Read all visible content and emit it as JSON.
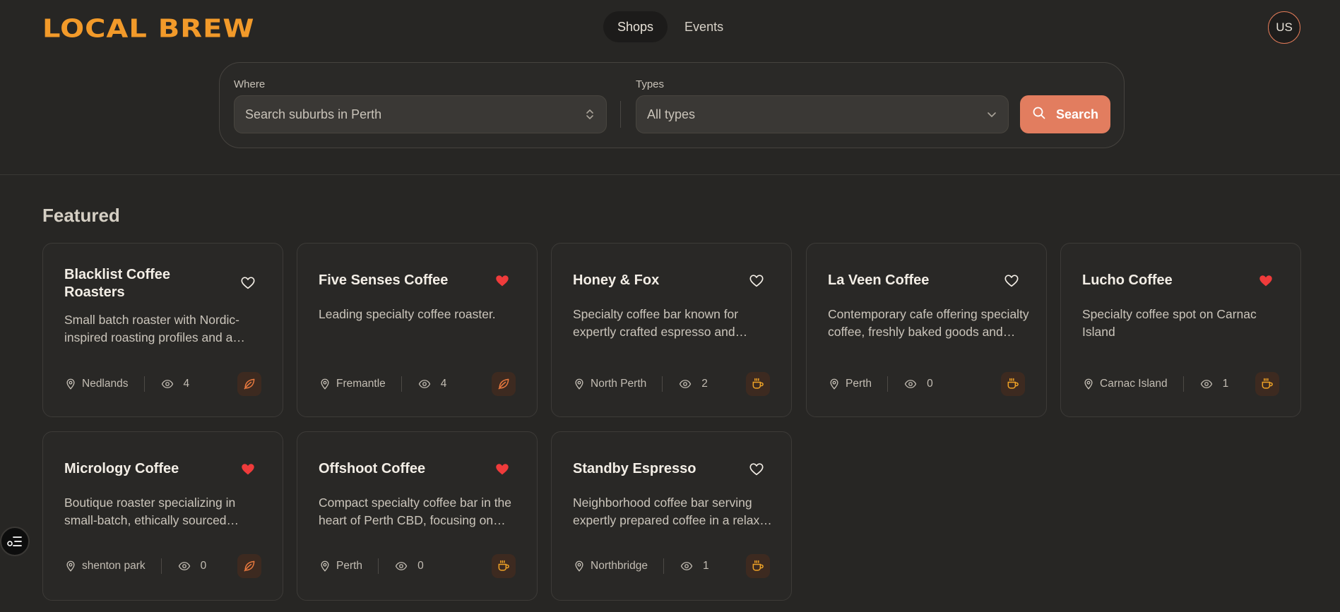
{
  "brand": {
    "logo_text": "LOCAL BREW",
    "accent": "#f29a2a"
  },
  "nav": {
    "tabs": [
      {
        "label": "Shops",
        "active": true
      },
      {
        "label": "Events",
        "active": false
      }
    ]
  },
  "user": {
    "initials": "US"
  },
  "search": {
    "where_label": "Where",
    "where_placeholder": "Search suburbs in Perth",
    "types_label": "Types",
    "types_value": "All types",
    "button_label": "Search",
    "button_color": "#e27d5f"
  },
  "featured": {
    "title": "Featured",
    "cards": [
      {
        "name": "Blacklist Coffee Roasters",
        "favorited": false,
        "description": "Small batch roaster with Nordic-inspired roasting profiles and a focus on transparency.",
        "location": "Nedlands",
        "views": "4",
        "type_icon": "leaf-icon"
      },
      {
        "name": "Five Senses Coffee",
        "favorited": true,
        "description": "Leading specialty coffee roaster.",
        "location": "Fremantle",
        "views": "4",
        "type_icon": "leaf-icon"
      },
      {
        "name": "Honey & Fox",
        "favorited": false,
        "description": "Specialty coffee bar known for expertly crafted espresso and pastries.",
        "location": "North Perth",
        "views": "2",
        "type_icon": "cup-icon"
      },
      {
        "name": "La Veen Coffee",
        "favorited": false,
        "description": "Contemporary cafe offering specialty coffee, freshly baked goods and brunch.",
        "location": "Perth",
        "views": "0",
        "type_icon": "cup-icon"
      },
      {
        "name": "Lucho Coffee",
        "favorited": true,
        "description": "Specialty coffee spot on Carnac Island",
        "location": "Carnac Island",
        "views": "1",
        "type_icon": "cup-icon"
      },
      {
        "name": "Micrology Coffee",
        "favorited": true,
        "description": "Boutique roaster specializing in small-batch, ethically sourced beans.",
        "location": "shenton park",
        "views": "0",
        "type_icon": "leaf-icon"
      },
      {
        "name": "Offshoot Coffee",
        "favorited": true,
        "description": "Compact specialty coffee bar in the heart of Perth CBD, focusing on quality.",
        "location": "Perth",
        "views": "0",
        "type_icon": "cup-icon"
      },
      {
        "name": "Standby Espresso",
        "favorited": false,
        "description": "Neighborhood coffee bar serving expertly prepared coffee in a relaxed space.",
        "location": "Northbridge",
        "views": "1",
        "type_icon": "cup-icon"
      }
    ]
  },
  "colors": {
    "heart_active": "#ef3b3b",
    "leaf_icon": "#e8793f",
    "cup_icon": "#f0a326"
  }
}
